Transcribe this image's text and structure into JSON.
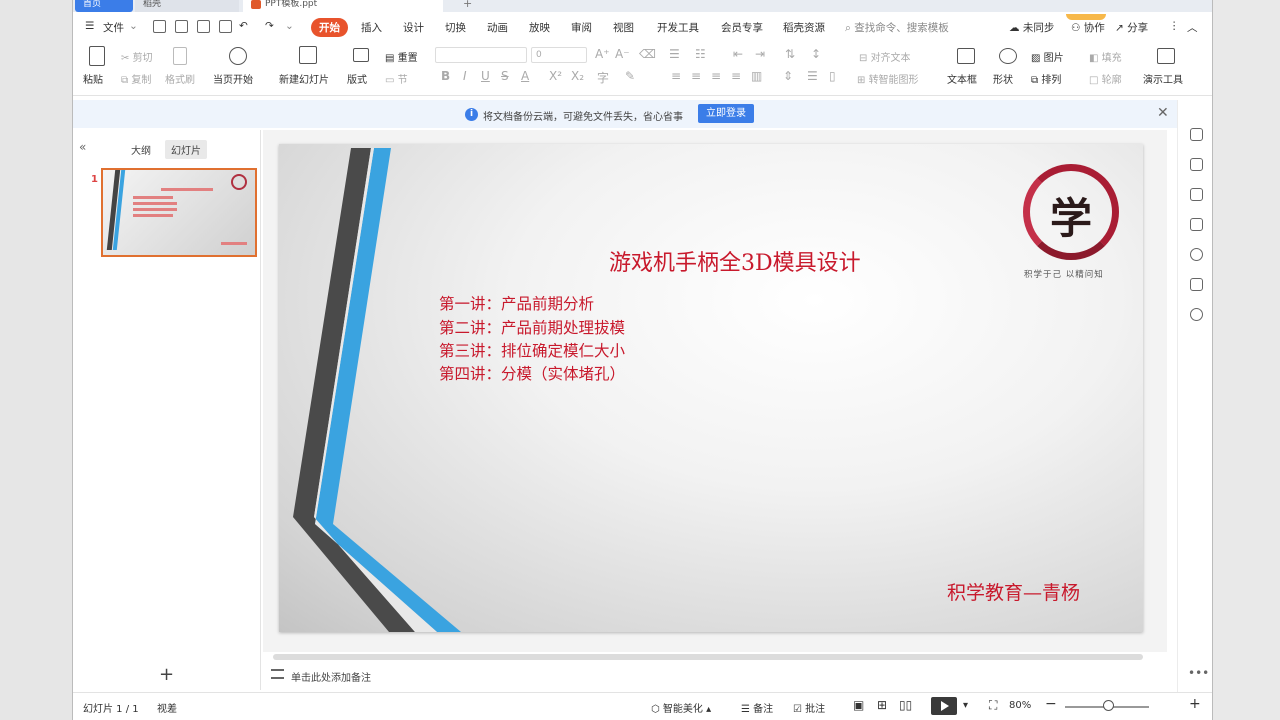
{
  "tabs": {
    "home": "首页",
    "daoke": "稻壳",
    "file": "PPT模板.ppt",
    "add": "+"
  },
  "menu": {
    "file": "文件",
    "items": [
      "开始",
      "插入",
      "设计",
      "切换",
      "动画",
      "放映",
      "审阅",
      "视图",
      "开发工具",
      "会员专享",
      "稻壳资源"
    ],
    "search_placeholder": "查找命令、搜索模板",
    "sync": "未同步",
    "collab": "协作",
    "share": "分享"
  },
  "ribbon": {
    "paste": "粘贴",
    "cut": "剪切",
    "copy": "复制",
    "format_painter": "格式刷",
    "from_current": "当页开始",
    "new_slide": "新建幻灯片",
    "layout": "版式",
    "reset": "重置",
    "section": "节",
    "font_size": "0",
    "align_text": "对齐文本",
    "smart_graphic": "转智能图形",
    "textbox": "文本框",
    "shape": "形状",
    "picture": "图片",
    "arrange": "排列",
    "fill": "填充",
    "outline": "轮廓",
    "presenter_tools": "演示工具"
  },
  "notice": {
    "text": "将文档备份云端，可避免文件丢失，省心省事",
    "login_button": "立即登录"
  },
  "panel": {
    "tab_outline": "大纲",
    "tab_slides": "幻灯片",
    "slide_number": "1"
  },
  "slide": {
    "title": "游戏机手柄全3D模具设计",
    "lectures": [
      "第一讲：产品前期分析",
      "第二讲：产品前期处理拔模",
      "第三讲：排位确定模仁大小",
      "第四讲：分模（实体堵孔）"
    ],
    "footer": "积学教育—青杨",
    "seal_char": "学",
    "seal_caption": "积学于己  以精问知"
  },
  "notes": {
    "placeholder": "单击此处添加备注"
  },
  "status": {
    "slide_info": "幻灯片 1 / 1",
    "theme": "视差",
    "beautify": "智能美化",
    "notes": "备注",
    "comments": "批注",
    "zoom": "80%"
  },
  "colors": {
    "accent": "#e8532c",
    "primary_blue": "#3b7de8",
    "slide_text_red": "#c8192c",
    "stripe_blue": "#3aa3e0",
    "stripe_dark": "#444444"
  },
  "zoom_level": 0.45
}
